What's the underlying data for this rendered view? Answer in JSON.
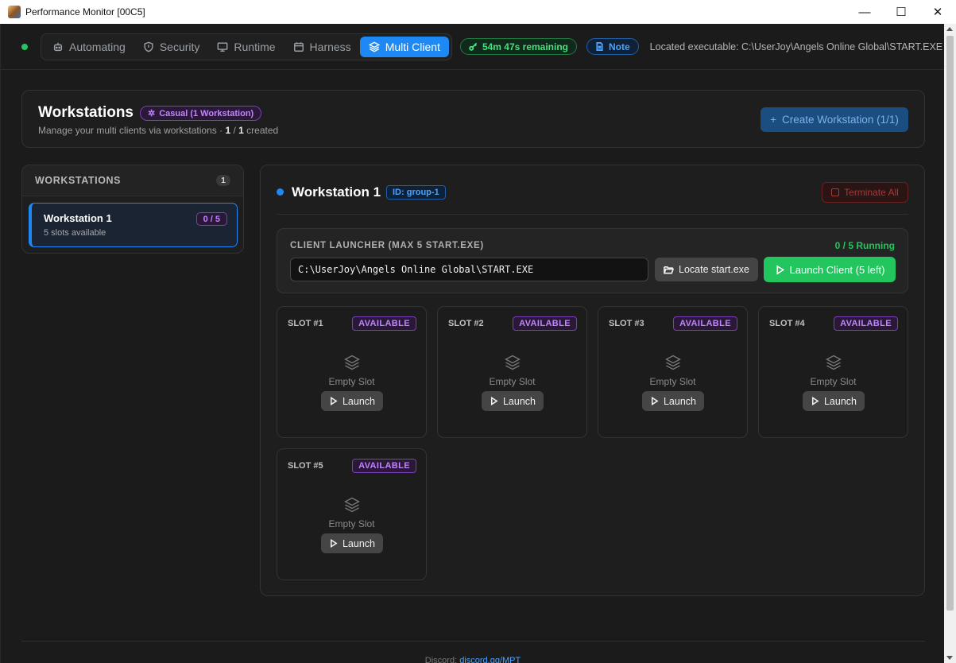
{
  "window": {
    "title": "Performance Monitor [00C5]",
    "minimize": "—",
    "maximize": "☐",
    "close": "✕"
  },
  "nav": {
    "tabs": [
      {
        "label": "Automating",
        "icon": "robot-icon"
      },
      {
        "label": "Security",
        "icon": "shield-icon"
      },
      {
        "label": "Runtime",
        "icon": "monitor-icon"
      },
      {
        "label": "Harness",
        "icon": "calendar-icon"
      },
      {
        "label": "Multi Client",
        "icon": "layers-icon",
        "active": true
      }
    ],
    "time_remaining": "54m 47s remaining",
    "note_label": "Note",
    "located_text": "Located executable: C:\\UserJoy\\Angels Online Global\\START.EXE"
  },
  "header": {
    "title": "Workstations",
    "tier_badge": "Casual (1 Workstation)",
    "subtitle_prefix": "Manage your multi clients via workstations · ",
    "created_count": "1",
    "created_sep": " / ",
    "created_max": "1",
    "subtitle_suffix": " created",
    "create_button": "Create Workstation (1/1)"
  },
  "sidebar": {
    "heading": "WORKSTATIONS",
    "count": "1",
    "items": [
      {
        "name": "Workstation 1",
        "slots_text": "5 slots available",
        "ratio": "0 / 5"
      }
    ]
  },
  "workstation": {
    "title": "Workstation 1",
    "id_badge": "ID: group-1",
    "terminate_label": "Terminate All",
    "launcher": {
      "label": "CLIENT LAUNCHER (MAX 5 START.EXE)",
      "running": "0 / 5 Running",
      "path_value": "C:\\UserJoy\\Angels Online Global\\START.EXE",
      "locate_label": "Locate start.exe",
      "launch_label": "Launch Client (5 left)"
    },
    "slots": [
      {
        "label": "SLOT #1",
        "status": "AVAILABLE",
        "empty": "Empty Slot",
        "launch": "Launch"
      },
      {
        "label": "SLOT #2",
        "status": "AVAILABLE",
        "empty": "Empty Slot",
        "launch": "Launch"
      },
      {
        "label": "SLOT #3",
        "status": "AVAILABLE",
        "empty": "Empty Slot",
        "launch": "Launch"
      },
      {
        "label": "SLOT #4",
        "status": "AVAILABLE",
        "empty": "Empty Slot",
        "launch": "Launch"
      },
      {
        "label": "SLOT #5",
        "status": "AVAILABLE",
        "empty": "Empty Slot",
        "launch": "Launch"
      }
    ]
  },
  "footer": {
    "prefix": "Discord: ",
    "link": "discord.gg/MPT"
  },
  "colors": {
    "accent": "#1e88f5",
    "success": "#22c55e",
    "purple": "#c084fc",
    "danger": "#a33b3b",
    "background": "#1a1a1a"
  }
}
